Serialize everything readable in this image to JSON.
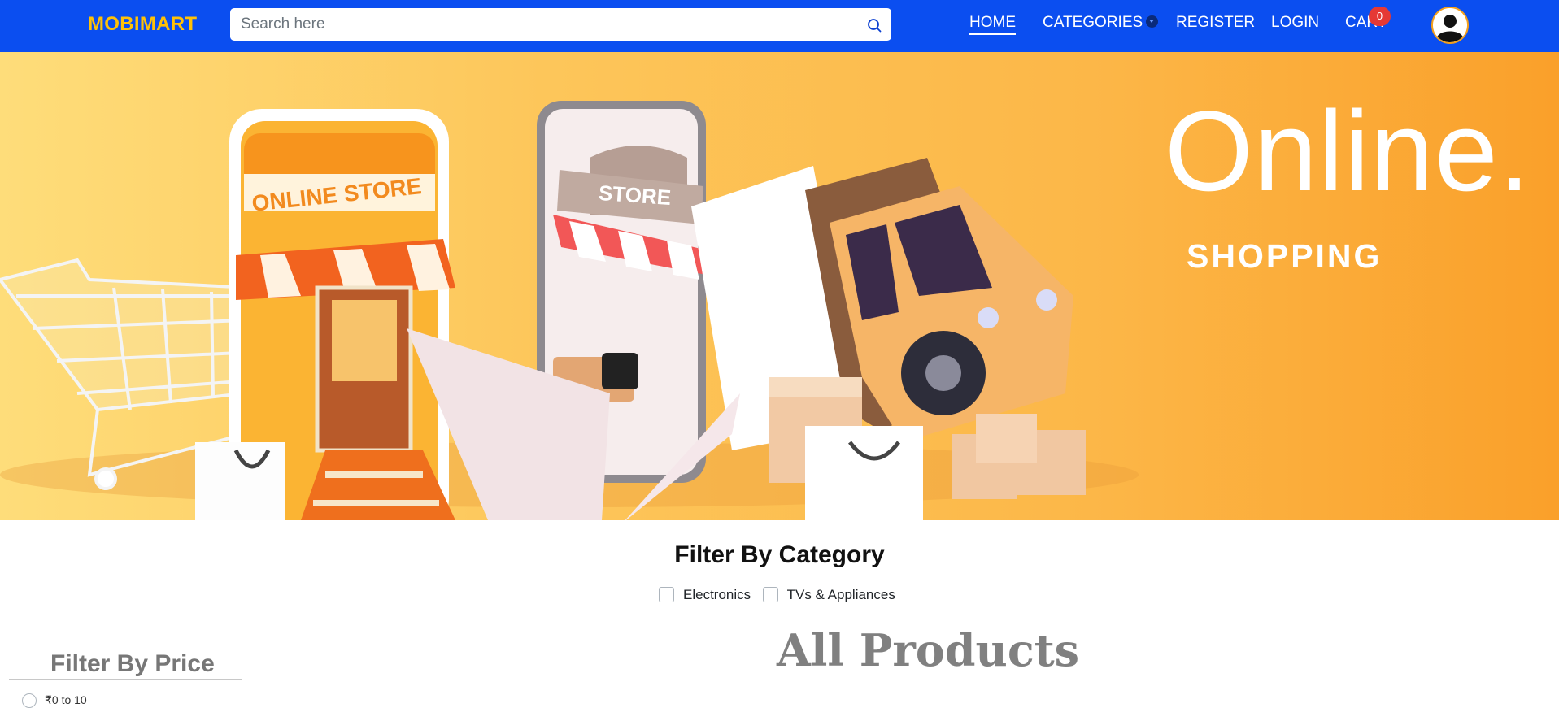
{
  "navbar": {
    "brand": "MOBIMART",
    "search_placeholder": "Search here",
    "links": {
      "home": "HOME",
      "categories": "CATEGORIES",
      "register": "REGISTER",
      "login": "LOGIN",
      "cart": "CART"
    },
    "cart_count": "0",
    "colors": {
      "background": "#0b4ef0",
      "brand": "#ffc107",
      "badge": "#e53935"
    },
    "icons": {
      "search": "search-icon",
      "categories_caret": "chevron-down-icon",
      "avatar": "user-icon"
    }
  },
  "banner": {
    "title": "Online.",
    "subtitle": "SHOPPING",
    "store_sign": "ONLINE STORE",
    "phone_sign": "STORE"
  },
  "filters": {
    "category_title": "Filter By Category",
    "categories": [
      {
        "label": "Electronics",
        "checked": false
      },
      {
        "label": "TVs & Appliances",
        "checked": false
      }
    ],
    "price_title": "Filter By Price",
    "price_options": [
      {
        "label": "₹0 to 10"
      }
    ]
  },
  "products": {
    "heading": "All Products"
  }
}
